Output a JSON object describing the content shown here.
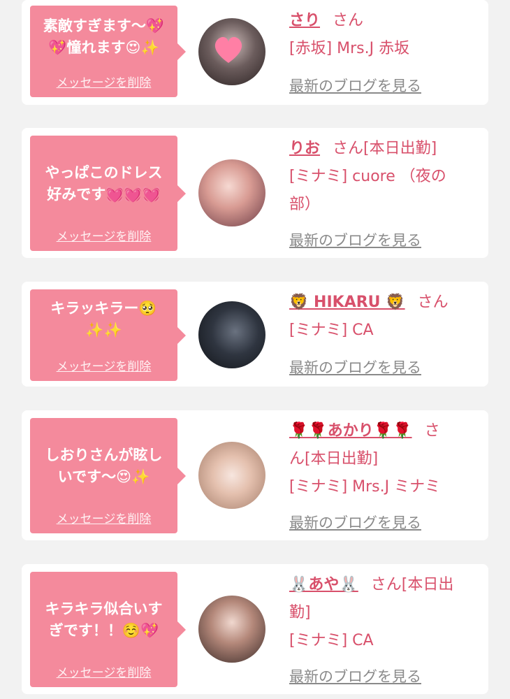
{
  "delete_label": "メッセージを削除",
  "blog_label": "最新のブログを見る",
  "cards": [
    {
      "message_l1": "素敵すぎます〜💖",
      "message_l2": "💖憧れます😍✨",
      "name": "さり",
      "san": "さん",
      "line1": "[赤坂] Mrs.J 赤坂",
      "line2": ""
    },
    {
      "message_l1": "やっぱこのドレス",
      "message_l2": "好みです💓💓💓",
      "name": "りお",
      "san": "さん[本日出勤]",
      "line1": "[ミナミ] cuore （夜の",
      "line2": "部）"
    },
    {
      "message_l1": "キラッキラー🥺",
      "message_l2": "✨✨",
      "name": "🦁 HIKARU 🦁",
      "san": "さん",
      "line1": "[ミナミ] CA",
      "line2": ""
    },
    {
      "message_l1": "しおりさんが眩し",
      "message_l2": "いです〜😍✨",
      "name": "🌹🌹あかり🌹🌹",
      "san": "さ",
      "line1": "ん[本日出勤]",
      "line2": "[ミナミ] Mrs.J ミナミ"
    },
    {
      "message_l1": "キラキラ似合いす",
      "message_l2": "ぎです！！☺️💖",
      "name": "🐰あや🐰",
      "san": "さん[本日出",
      "line1": "勤]",
      "line2": "[ミナミ] CA"
    }
  ]
}
